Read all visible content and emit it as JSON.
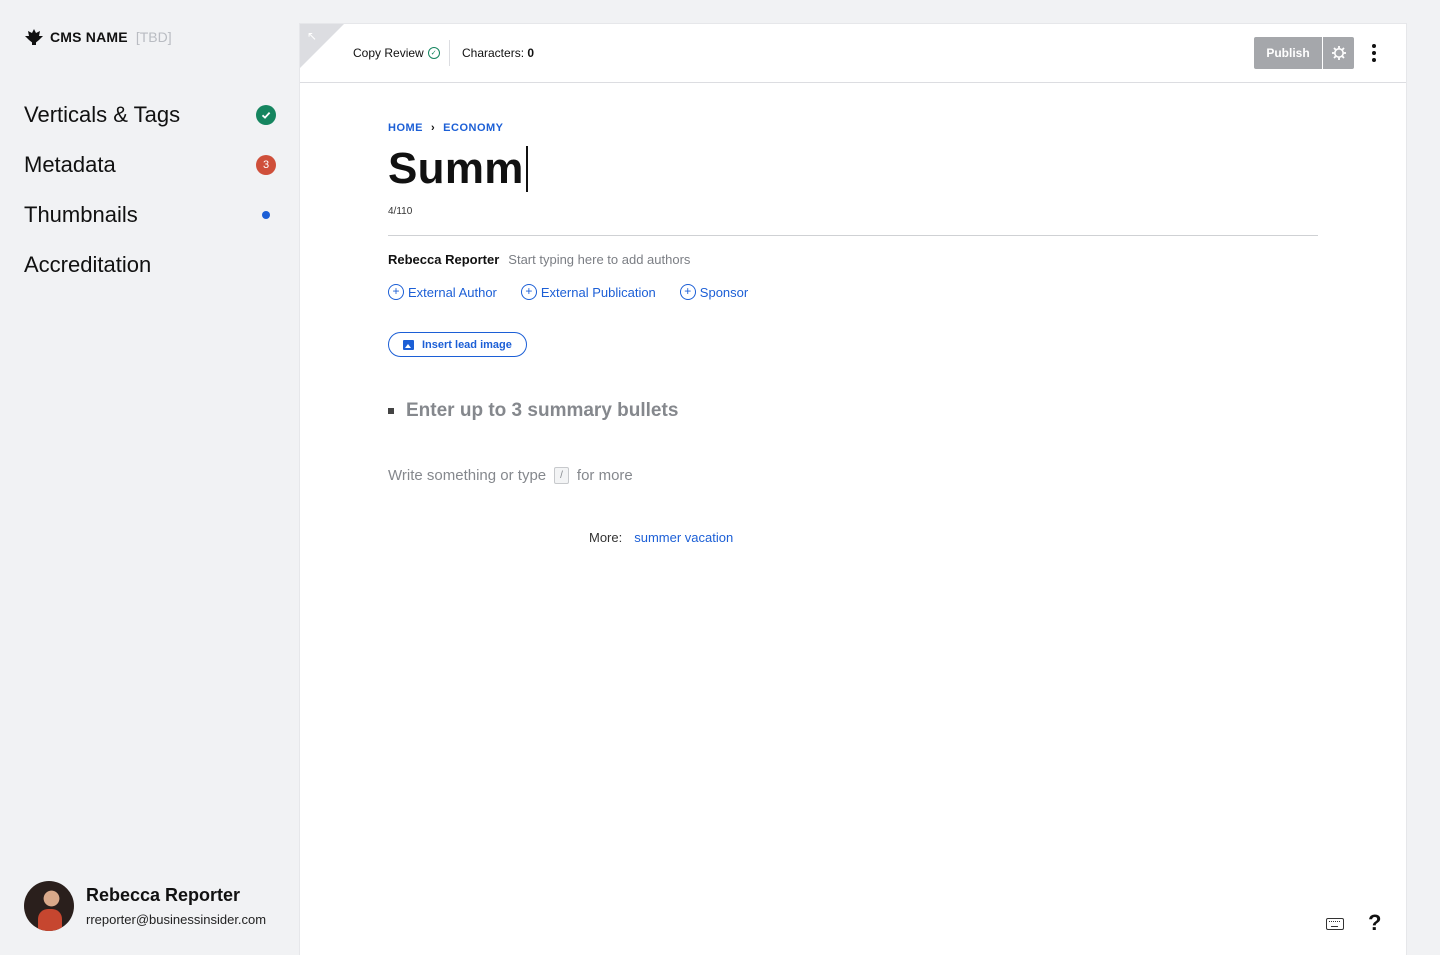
{
  "brand": {
    "name": "CMS NAME",
    "tag": "[TBD]"
  },
  "sidebar": {
    "items": [
      {
        "label": "Verticals & Tags",
        "status": "complete"
      },
      {
        "label": "Metadata",
        "count": "3"
      },
      {
        "label": "Thumbnails",
        "status": "dot"
      },
      {
        "label": "Accreditation"
      }
    ]
  },
  "user": {
    "name": "Rebecca Reporter",
    "email": "rreporter@businessinsider.com"
  },
  "toolbar": {
    "copy_review": "Copy Review",
    "characters_label": "Characters:",
    "characters_value": "0",
    "publish_label": "Publish"
  },
  "article": {
    "breadcrumb": [
      "HOME",
      "ECONOMY"
    ],
    "title": "Summ",
    "title_count": "4/110",
    "author": "Rebecca Reporter",
    "author_placeholder": "Start typing here to add authors",
    "add_links": [
      "External Author",
      "External Publication",
      "Sponsor"
    ],
    "lead_image_label": "Insert lead image",
    "bullets_placeholder": "Enter up to 3 summary bullets",
    "write_prefix": "Write something or type",
    "write_key": "/",
    "write_suffix": "for more",
    "more_label": "More:",
    "more_link": "summer vacation"
  },
  "colors": {
    "accent": "#1c5fd6",
    "success": "#15855f",
    "alert": "#cf4f3a",
    "disabled": "#a5a7ab"
  }
}
